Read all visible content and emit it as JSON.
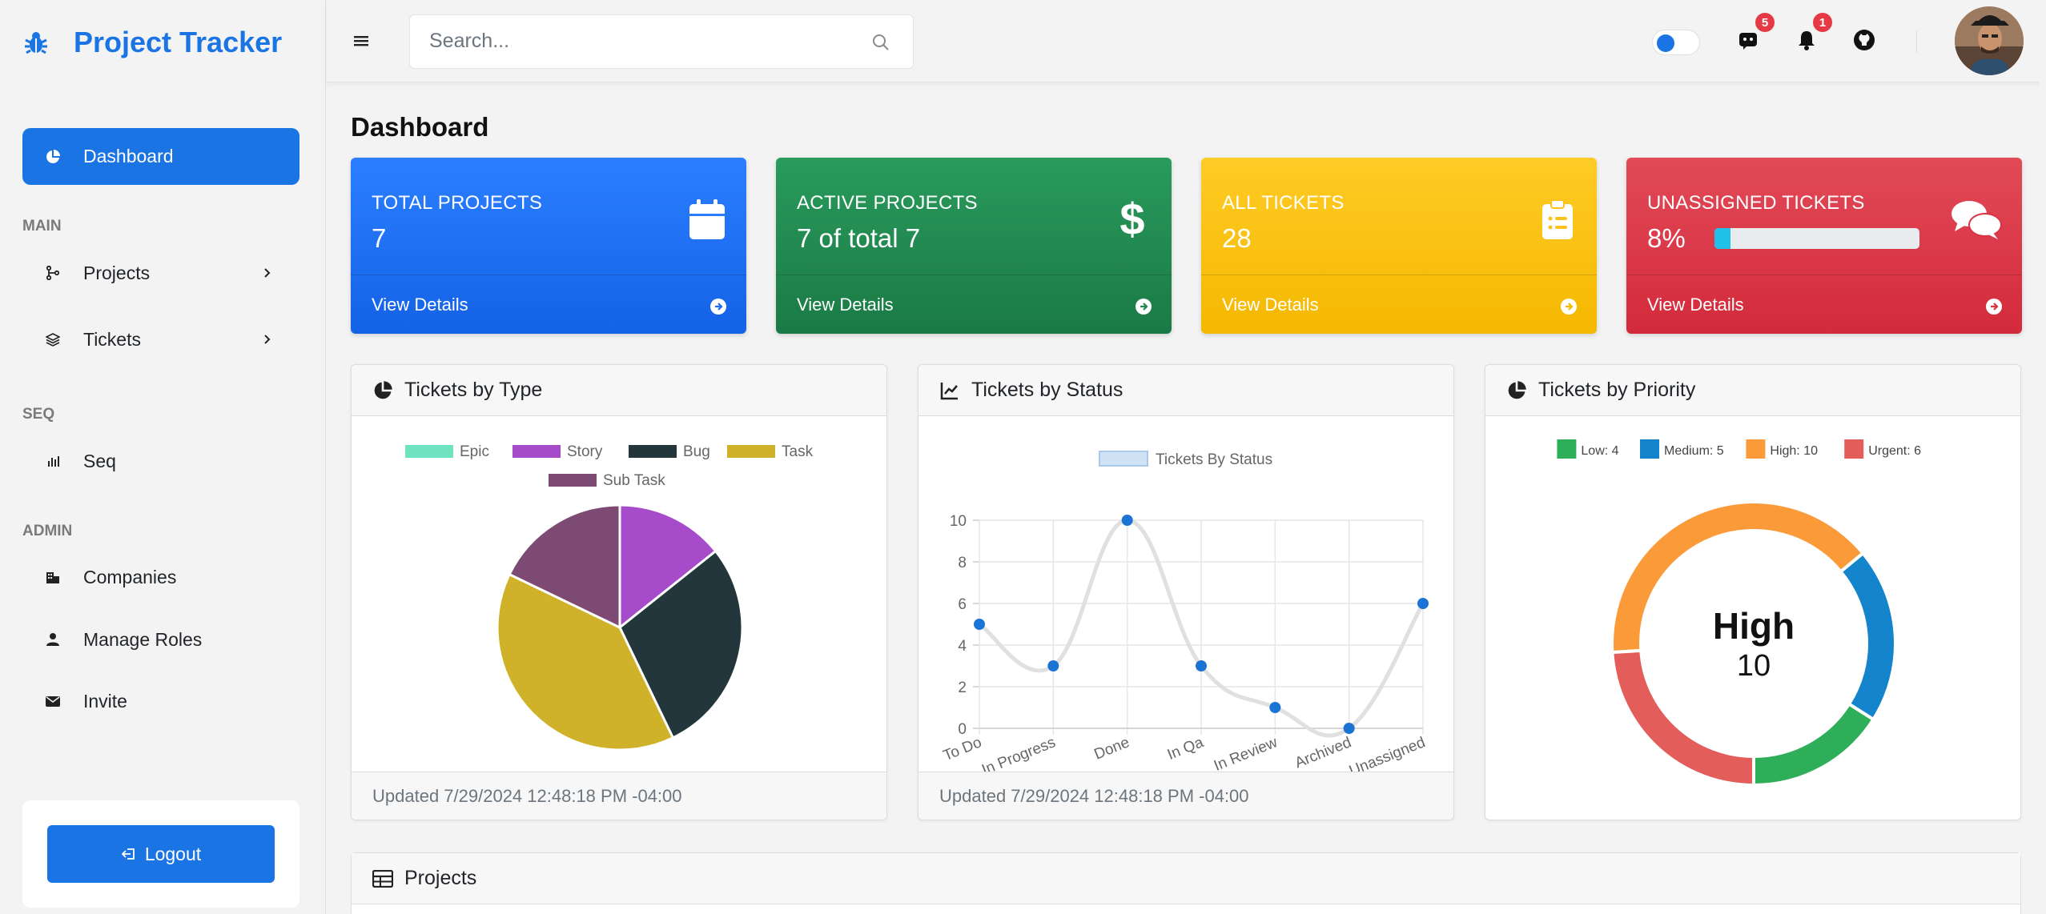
{
  "brand": {
    "title": "Project Tracker"
  },
  "sidebar": {
    "active": "Dashboard",
    "sections": {
      "main": "MAIN",
      "seq": "SEQ",
      "admin": "ADMIN"
    },
    "items": {
      "projects": "Projects",
      "tickets": "Tickets",
      "seq": "Seq",
      "companies": "Companies",
      "roles": "Manage Roles",
      "invite": "Invite"
    },
    "logout": "Logout"
  },
  "topbar": {
    "search_placeholder": "Search...",
    "messages_count": "5",
    "notifications_count": "1"
  },
  "page": {
    "title": "Dashboard"
  },
  "stats": {
    "total_projects": {
      "label": "TOTAL PROJECTS",
      "value": "7",
      "link": "View Details"
    },
    "active_projects": {
      "label": "ACTIVE PROJECTS",
      "value": "7 of total 7",
      "link": "View Details"
    },
    "all_tickets": {
      "label": "ALL TICKETS",
      "value": "28",
      "link": "View Details"
    },
    "unassigned": {
      "label": "UNASSIGNED TICKETS",
      "value": "8%",
      "progress": 0.08,
      "link": "View Details"
    }
  },
  "cards": {
    "type": {
      "title": "Tickets by Type",
      "updated": "Updated 7/29/2024 12:48:18 PM -04:00"
    },
    "status": {
      "title": "Tickets by Status",
      "updated": "Updated 7/29/2024 12:48:18 PM -04:00"
    },
    "priority": {
      "title": "Tickets by Priority",
      "center_label": "High",
      "center_value": "10"
    },
    "projects": {
      "title": "Projects"
    }
  },
  "chart_data": [
    {
      "type": "pie",
      "title": "Tickets by Type",
      "legend_placement": "top",
      "categories": [
        "Epic",
        "Story",
        "Bug",
        "Task",
        "Sub Task"
      ],
      "values": [
        0,
        4,
        8,
        11,
        5
      ],
      "colors": [
        "#6fe3c0",
        "#a64bc9",
        "#22363b",
        "#cfb229",
        "#7c4a72"
      ]
    },
    {
      "type": "line",
      "title": "Tickets by Status",
      "legend_placement": "top",
      "categories": [
        "To Do",
        "In Progress",
        "Done",
        "In Qa",
        "In Review",
        "Archived",
        "Unassigned"
      ],
      "series": [
        {
          "name": "Tickets By Status",
          "values": [
            5,
            3,
            10,
            3,
            1,
            0,
            6
          ]
        }
      ],
      "ylim": [
        0,
        10
      ],
      "yticks": [
        0,
        2,
        4,
        6,
        8,
        10
      ],
      "grid": true,
      "line_color": "#e0e0e0",
      "point_color": "#1b74d4"
    },
    {
      "type": "pie",
      "subtype": "doughnut",
      "title": "Tickets by Priority",
      "legend_placement": "top",
      "categories": [
        "Low",
        "Medium",
        "High",
        "Urgent"
      ],
      "legend_labels": [
        "Low: 4",
        "Medium: 5",
        "High: 10",
        "Urgent: 6"
      ],
      "values": [
        4,
        5,
        10,
        6
      ],
      "colors": [
        "#2fae59",
        "#1485cc",
        "#fb9a38",
        "#e35d5a"
      ]
    }
  ]
}
